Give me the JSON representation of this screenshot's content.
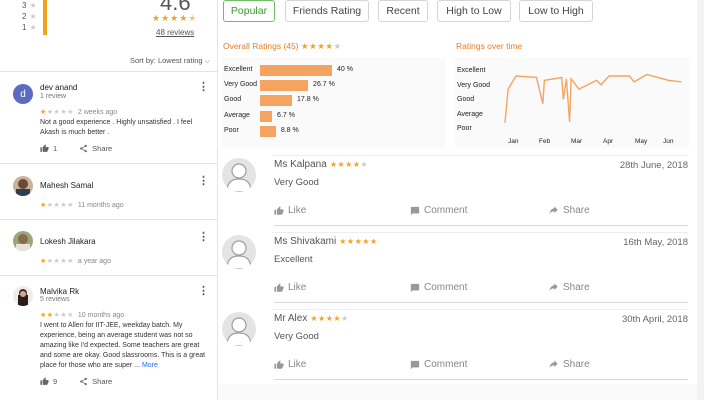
{
  "left": {
    "histogram": [
      {
        "label": "3",
        "stars": "★"
      },
      {
        "label": "2",
        "stars": "★"
      },
      {
        "label": "1",
        "stars": "★"
      }
    ],
    "average_display": "4.6",
    "review_count_link": "48 reviews",
    "sort_label": "Sort by:",
    "sort_value": "Lowest rating",
    "reviews": [
      {
        "name": "dev anand",
        "avatar_letter": "d",
        "avatar_color": "#5c6bc0",
        "sub": "1 review",
        "rating": 1,
        "when": "2 weeks ago",
        "text": "Not a good experience . Highly unsatisfied . I feel Akash is much better .",
        "likes": "1",
        "share": "Share"
      },
      {
        "name": "Mahesh Samal",
        "sub": "",
        "rating": 1,
        "when": "11 months ago"
      },
      {
        "name": "Lokesh Jilakara",
        "sub": "",
        "rating": 1,
        "when": "a year ago"
      },
      {
        "name": "Malvika Rk",
        "sub": "5 reviews",
        "rating": 2,
        "when": "10 months ago",
        "text": "I went to Allen for IIT-JEE, weekday batch. My experience, being an average student was not so amazing like I'd expected. Some teachers are great and some are okay. Good slassrooms. This is a great place for those who are super ...",
        "more": "More",
        "likes": "9",
        "share": "Share"
      }
    ]
  },
  "tabs": [
    "Popular",
    "Friends Rating",
    "Recent",
    "High to Low",
    "Low to High"
  ],
  "overall": {
    "title": "Overall Ratings (45)",
    "rating": 4,
    "chart_data": {
      "type": "bar",
      "categories": [
        "Excellent",
        "Very Good",
        "Good",
        "Average",
        "Poor"
      ],
      "values": [
        40,
        26.7,
        17.8,
        6.7,
        8.8
      ],
      "labels": [
        "40 %",
        "26.7 %",
        "17.8 %",
        "6.7 %",
        "8.8 %"
      ]
    }
  },
  "over_time": {
    "title": "Ratings over time",
    "chart_data": {
      "type": "line",
      "y_categories": [
        "Excellent",
        "Very Good",
        "Good",
        "Average",
        "Poor"
      ],
      "x_labels": [
        "Jan",
        "Feb",
        "Mar",
        "Apr",
        "May",
        "Jun"
      ],
      "points": [
        [
          0,
          0.5
        ],
        [
          0.1,
          2.8
        ],
        [
          0.35,
          3.7
        ],
        [
          1.0,
          3.6
        ],
        [
          1.2,
          1.8
        ],
        [
          1.25,
          3.4
        ],
        [
          1.8,
          3.6
        ],
        [
          1.85,
          2.1
        ],
        [
          1.95,
          3.5
        ],
        [
          2.05,
          0.55
        ],
        [
          2.1,
          3.5
        ],
        [
          2.35,
          2.8
        ],
        [
          2.9,
          3.4
        ],
        [
          3.05,
          3.1
        ],
        [
          3.3,
          3.7
        ],
        [
          3.95,
          3.7
        ],
        [
          4.1,
          3.3
        ],
        [
          4.5,
          3.8
        ],
        [
          5.2,
          3.4
        ],
        [
          5.6,
          3.3
        ]
      ],
      "color": "#f4a460"
    }
  },
  "reviews": [
    {
      "name": "Ms Kalpana",
      "rating": 4,
      "date": "28th June, 2018",
      "text": "Very Good"
    },
    {
      "name": "Ms Shivakami",
      "rating": 5,
      "date": "16th May, 2018",
      "text": "Excellent"
    },
    {
      "name": "Mr Alex",
      "rating": 4,
      "date": "30th April, 2018",
      "text": "Very Good"
    }
  ],
  "actions": {
    "like": "Like",
    "comment": "Comment",
    "share": "Share"
  },
  "colors": {
    "accent": "#f4a21b",
    "bar": "#f4a460",
    "tab_active": "#3a9a2e"
  }
}
